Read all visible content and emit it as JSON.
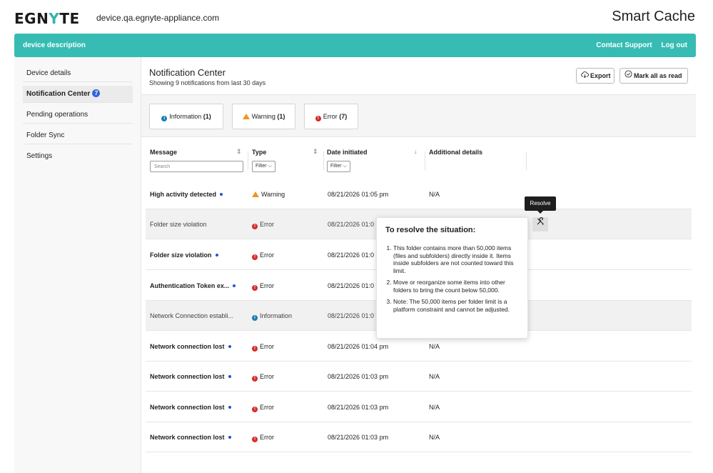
{
  "header": {
    "logo_pre": "EGN",
    "logo_y": "Y",
    "logo_post": "TE",
    "device_host": "device.qa.egnyte-appliance.com",
    "product_name": "Smart Cache"
  },
  "tealbar": {
    "description": "device description",
    "contact_support": "Contact Support",
    "logout": "Log out"
  },
  "sidebar": {
    "items": [
      {
        "label": "Device details"
      },
      {
        "label": "Notification Center",
        "badge": "7"
      },
      {
        "label": "Pending operations"
      },
      {
        "label": "Folder Sync"
      },
      {
        "label": "Settings"
      }
    ]
  },
  "main": {
    "title": "Notification Center",
    "subtitle": "Showing 9 notifications from last 30 days",
    "export_label": "Export",
    "mark_all_label": "Mark all as read",
    "chips": [
      {
        "label": "Information",
        "count": "(1)"
      },
      {
        "label": "Warning",
        "count": "(1)"
      },
      {
        "label": "Error",
        "count": "(7)"
      }
    ]
  },
  "table": {
    "headers": {
      "message": "Message",
      "type": "Type",
      "date": "Date initiated",
      "details": "Additional details"
    },
    "search_placeholder": "Search",
    "filter_label": "Filter",
    "rows": [
      {
        "message": "High activity detected",
        "type": "Warning",
        "date": "08/21/2026 01:05 pm",
        "details": "N/A"
      },
      {
        "message": "Folder size violation",
        "type": "Error",
        "date": "08/21/2026 01:0",
        "details": ""
      },
      {
        "message": "Folder size violation",
        "type": "Error",
        "date": "08/21/2026 01:0",
        "details": ""
      },
      {
        "message": "Authentication Token ex...",
        "type": "Error",
        "date": "08/21/2026 01:0",
        "details": ""
      },
      {
        "message": "Network Connection establi...",
        "type": "Information",
        "date": "08/21/2026 01:0",
        "details": ""
      },
      {
        "message": "Network connection lost",
        "type": "Error",
        "date": "08/21/2026 01:04 pm",
        "details": "N/A"
      },
      {
        "message": "Network connection lost",
        "type": "Error",
        "date": "08/21/2026 01:03 pm",
        "details": "N/A"
      },
      {
        "message": "Network connection lost",
        "type": "Error",
        "date": "08/21/2026 01:03 pm",
        "details": "N/A"
      },
      {
        "message": "Network connection lost",
        "type": "Error",
        "date": "08/21/2026 01:03 pm",
        "details": "N/A"
      }
    ]
  },
  "resolve": {
    "tooltip": "Resolve",
    "popover_title": "To resolve the situation:",
    "steps": [
      "This folder contains more than 50,000 items (files and subfolders) directly inside it. Items inside subfolders are not counted toward this limit.",
      "Move or reorganize some items into other folders to bring the count below 50,000.",
      "Note: The 50,000 items per folder limit is a platform constraint and cannot be adjusted."
    ]
  },
  "colors": {
    "accent_teal": "#36bcb3",
    "info_blue": "#1c7bb4",
    "warning_orange": "#f0961e",
    "error_red": "#d52b2b",
    "badge_blue": "#2f66d8"
  }
}
